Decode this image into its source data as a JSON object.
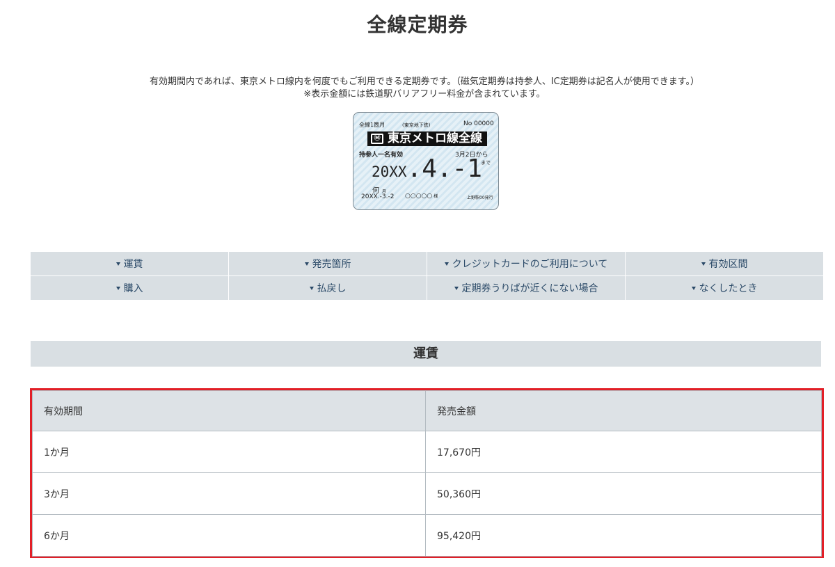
{
  "page": {
    "title": "全線定期券"
  },
  "intro": {
    "line1": "有効期間内であれば、東京メトロ線内を何度でもご利用できる定期券です。（磁気定期券は持参人、IC定期券は記名人が使用できます。）",
    "line2": "※表示金額には鉄道駅バリアフリー料金が含まれています。"
  },
  "ticket": {
    "top_left": "全線1箇月",
    "top_mid": "(東京地下鉄)",
    "top_right": "No 00000",
    "logo_icon": "tokyo-metro-logo-icon",
    "band": "東京メトロ線全線",
    "valid_left": "持参人一名有効",
    "valid_right": "3月2日から",
    "made": "まで",
    "date_prefix": "20XX",
    "date_main": ".4.-1",
    "nan": "何",
    "nan_small": "月",
    "issue_date": "20XX.-3.-2",
    "name_mark": "○○○○○",
    "name_suffix": "様",
    "issuer": "上野駅00発行"
  },
  "nav": {
    "items": [
      {
        "label": "運賃"
      },
      {
        "label": "発売箇所"
      },
      {
        "label": "クレジットカードのご利用について"
      },
      {
        "label": "有効区間"
      },
      {
        "label": "購入"
      },
      {
        "label": "払戻し"
      },
      {
        "label": "定期券うりばが近くにない場合"
      },
      {
        "label": "なくしたとき"
      }
    ],
    "icon": "triangle-down-icon"
  },
  "fare_section": {
    "title": "運賃"
  },
  "fare_table": {
    "headers": [
      "有効期間",
      "発売金額"
    ],
    "rows": [
      [
        "1か月",
        "17,670円"
      ],
      [
        "3か月",
        "50,360円"
      ],
      [
        "6か月",
        "95,420円"
      ]
    ],
    "highlight_color": "#e21f27"
  }
}
